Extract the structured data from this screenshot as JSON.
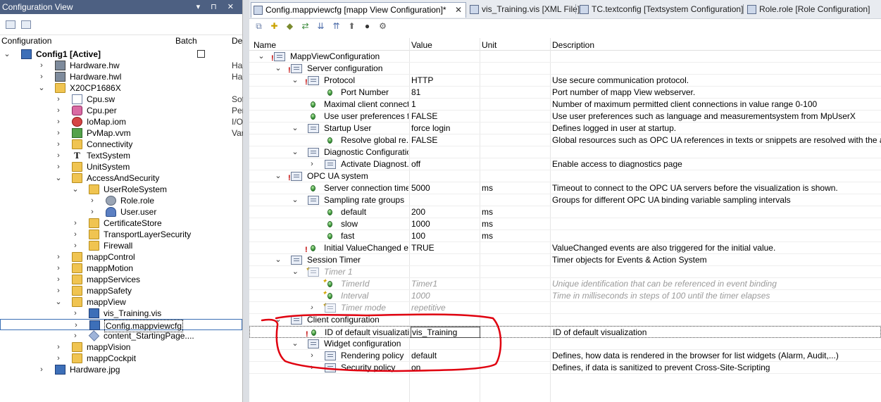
{
  "left_pane": {
    "title": "Configuration View",
    "title_controls": "▾ ⊓ ✕",
    "headers": {
      "configuration": "Configuration",
      "batch": "Batch",
      "desc": "Des"
    },
    "tree": [
      {
        "label": "Config1 [Active]",
        "depth": 0,
        "expander": "⌄",
        "icon": "config-icon",
        "bold": true,
        "extra": ""
      },
      {
        "label": "Hardware.hw",
        "depth": 1,
        "expander": "›",
        "icon": "hardware-icon",
        "extra": "Har"
      },
      {
        "label": "Hardware.hwl",
        "depth": 1,
        "expander": "›",
        "icon": "hardware-icon",
        "extra": "Har"
      },
      {
        "label": "X20CP1686X",
        "depth": 1,
        "expander": "⌄",
        "icon": "cpu-icon",
        "extra": ""
      },
      {
        "label": "Cpu.sw",
        "depth": 2,
        "expander": "›",
        "icon": "file-icon",
        "extra": "Sof"
      },
      {
        "label": "Cpu.per",
        "depth": 2,
        "expander": "›",
        "icon": "gear-icon",
        "extra": "Per"
      },
      {
        "label": "IoMap.iom",
        "depth": 2,
        "expander": "›",
        "icon": "iomap-icon",
        "extra": "I/O"
      },
      {
        "label": "PvMap.vvm",
        "depth": 2,
        "expander": "›",
        "icon": "pvmap-icon",
        "extra": "Var"
      },
      {
        "label": "Connectivity",
        "depth": 2,
        "expander": "›",
        "icon": "folder-icon",
        "extra": ""
      },
      {
        "label": "TextSystem",
        "depth": 2,
        "expander": "›",
        "icon": "text-icon",
        "extra": ""
      },
      {
        "label": "UnitSystem",
        "depth": 2,
        "expander": "›",
        "icon": "folder-icon",
        "extra": ""
      },
      {
        "label": "AccessAndSecurity",
        "depth": 2,
        "expander": "⌄",
        "icon": "security-icon",
        "extra": ""
      },
      {
        "label": "UserRoleSystem",
        "depth": 3,
        "expander": "⌄",
        "icon": "folder-icon",
        "extra": ""
      },
      {
        "label": "Role.role",
        "depth": 4,
        "expander": "›",
        "icon": "role-icon",
        "extra": ""
      },
      {
        "label": "User.user",
        "depth": 4,
        "expander": "›",
        "icon": "user-icon",
        "extra": ""
      },
      {
        "label": "CertificateStore",
        "depth": 3,
        "expander": "›",
        "icon": "folder-icon",
        "extra": ""
      },
      {
        "label": "TransportLayerSecurity",
        "depth": 3,
        "expander": "›",
        "icon": "folder-icon",
        "extra": ""
      },
      {
        "label": "Firewall",
        "depth": 3,
        "expander": "›",
        "icon": "folder-icon",
        "extra": ""
      },
      {
        "label": "mappControl",
        "depth": 2,
        "expander": "›",
        "icon": "folder-icon",
        "extra": ""
      },
      {
        "label": "mappMotion",
        "depth": 2,
        "expander": "›",
        "icon": "folder-icon",
        "extra": ""
      },
      {
        "label": "mappServices",
        "depth": 2,
        "expander": "›",
        "icon": "folder-icon",
        "extra": ""
      },
      {
        "label": "mappSafety",
        "depth": 2,
        "expander": "›",
        "icon": "folder-icon",
        "extra": ""
      },
      {
        "label": "mappView",
        "depth": 2,
        "expander": "⌄",
        "icon": "folder-icon",
        "extra": ""
      },
      {
        "label": "vis_Training.vis",
        "depth": 3,
        "expander": "›",
        "icon": "vis-icon",
        "extra": ""
      },
      {
        "label": "Config.mappviewcfg",
        "depth": 3,
        "expander": "›",
        "icon": "vis-icon",
        "extra": "",
        "selected": true
      },
      {
        "label": "content_StartingPage....",
        "depth": 3,
        "expander": "›",
        "icon": "content-icon",
        "extra": ""
      },
      {
        "label": "mappVision",
        "depth": 2,
        "expander": "›",
        "icon": "folder-icon",
        "extra": ""
      },
      {
        "label": "mappCockpit",
        "depth": 2,
        "expander": "›",
        "icon": "folder-icon",
        "extra": ""
      },
      {
        "label": "Hardware.jpg",
        "depth": 1,
        "expander": "›",
        "icon": "image-icon",
        "extra": ""
      }
    ]
  },
  "tabs": [
    {
      "label": "Config.mappviewcfg [mapp View Configuration]*",
      "active": true,
      "close": "✕"
    },
    {
      "label": "vis_Training.vis [XML File]",
      "active": false
    },
    {
      "label": "TC.textconfig [Textsystem Configuration]",
      "active": false
    },
    {
      "label": "Role.role [Role Configuration]",
      "active": false
    }
  ],
  "toolbar": [
    "⧉",
    "✚",
    "◆",
    "⇄",
    "⇊",
    "⇈",
    "⬆",
    "●",
    "⚙"
  ],
  "grid": {
    "headers": {
      "name": "Name",
      "value": "Value",
      "unit": "Unit",
      "description": "Description"
    },
    "rows": [
      {
        "name": "MappViewConfiguration",
        "depth": 0,
        "exp": "⌄",
        "kind": "obj",
        "warn": true,
        "value": "",
        "unit": "",
        "desc": ""
      },
      {
        "name": "Server configuration",
        "depth": 1,
        "exp": "⌄",
        "kind": "obj",
        "warn": true,
        "value": "",
        "unit": "",
        "desc": ""
      },
      {
        "name": "Protocol",
        "depth": 2,
        "exp": "⌄",
        "kind": "obj",
        "warn": true,
        "value": "HTTP",
        "unit": "",
        "desc": "Use secure communication protocol."
      },
      {
        "name": "Port Number",
        "depth": 3,
        "exp": "",
        "kind": "dot",
        "value": "81",
        "unit": "",
        "desc": "Port number of mapp View webserver."
      },
      {
        "name": "Maximal client connect...",
        "depth": 2,
        "exp": "",
        "kind": "dot",
        "value": "1",
        "unit": "",
        "desc": "Number of maximum permitted client connections in value range 0-100"
      },
      {
        "name": "Use user preferences f...",
        "depth": 2,
        "exp": "",
        "kind": "dot",
        "value": "FALSE",
        "unit": "",
        "desc": "Use user preferences such as language and measurementsystem from MpUserX"
      },
      {
        "name": "Startup User",
        "depth": 2,
        "exp": "⌄",
        "kind": "obj",
        "value": "force login",
        "unit": "",
        "desc": "Defines logged in user at startup."
      },
      {
        "name": "Resolve global re...",
        "depth": 3,
        "exp": "",
        "kind": "dot",
        "value": "FALSE",
        "unit": "",
        "desc": "Global resources such as OPC UA references in texts or snippets are resolved with the anonymous t"
      },
      {
        "name": "Diagnostic Configuration",
        "depth": 2,
        "exp": "⌄",
        "kind": "obj",
        "value": "",
        "unit": "",
        "desc": ""
      },
      {
        "name": "Activate Diagnost...",
        "depth": 3,
        "exp": "›",
        "kind": "obj",
        "value": "off",
        "unit": "",
        "desc": "Enable access to diagnostics page"
      },
      {
        "name": "OPC UA system",
        "depth": 1,
        "exp": "⌄",
        "kind": "obj",
        "warn": true,
        "value": "",
        "unit": "",
        "desc": ""
      },
      {
        "name": "Server connection time...",
        "depth": 2,
        "exp": "",
        "kind": "dot",
        "value": "5000",
        "unit": "ms",
        "desc": "Timeout to connect to the OPC UA servers before the visualization is shown."
      },
      {
        "name": "Sampling rate groups",
        "depth": 2,
        "exp": "⌄",
        "kind": "obj",
        "value": "",
        "unit": "",
        "desc": "Groups for different OPC UA binding variable sampling intervals"
      },
      {
        "name": "default",
        "depth": 3,
        "exp": "",
        "kind": "dot",
        "value": "200",
        "unit": "ms",
        "desc": ""
      },
      {
        "name": "slow",
        "depth": 3,
        "exp": "",
        "kind": "dot",
        "value": "1000",
        "unit": "ms",
        "desc": ""
      },
      {
        "name": "fast",
        "depth": 3,
        "exp": "",
        "kind": "dot",
        "value": "100",
        "unit": "ms",
        "desc": ""
      },
      {
        "name": "Initial ValueChanged e...",
        "depth": 2,
        "exp": "",
        "kind": "dot",
        "warn": true,
        "value": "TRUE",
        "unit": "",
        "desc": "ValueChanged events are also triggered for the initial value."
      },
      {
        "name": "Session Timer",
        "depth": 1,
        "exp": "⌄",
        "kind": "obj",
        "value": "",
        "unit": "",
        "desc": "Timer objects for Events & Action System"
      },
      {
        "name": "Timer 1",
        "depth": 2,
        "exp": "⌄",
        "kind": "obj",
        "dim": true,
        "spark": true,
        "value": "",
        "unit": "",
        "desc": ""
      },
      {
        "name": "TimerId",
        "depth": 3,
        "exp": "",
        "kind": "dot",
        "dim": true,
        "spark": true,
        "value": "Timer1",
        "unit": "",
        "desc": "Unique identification that can be referenced in event binding"
      },
      {
        "name": "Interval",
        "depth": 3,
        "exp": "",
        "kind": "dot",
        "dim": true,
        "spark": true,
        "value": "1000",
        "unit": "",
        "desc": "Time in milliseconds in steps of 100 until the timer elapses"
      },
      {
        "name": "Timer mode",
        "depth": 3,
        "exp": "›",
        "kind": "obj",
        "dim": true,
        "spark": true,
        "value": "repetitive",
        "unit": "",
        "desc": ""
      },
      {
        "name": "Client configuration",
        "depth": 1,
        "exp": "⌄",
        "kind": "obj",
        "value": "",
        "unit": "",
        "desc": ""
      },
      {
        "name": "ID of default visualization",
        "depth": 2,
        "exp": "",
        "kind": "dot",
        "warn": true,
        "value": "vis_Training",
        "unit": "",
        "desc": "ID of default visualization",
        "editing": true
      },
      {
        "name": "Widget configuration",
        "depth": 2,
        "exp": "⌄",
        "kind": "obj",
        "value": "",
        "unit": "",
        "desc": ""
      },
      {
        "name": "Rendering policy",
        "depth": 3,
        "exp": "›",
        "kind": "obj",
        "value": "default",
        "unit": "",
        "desc": "Defines, how data is rendered in the browser for list widgets (Alarm, Audit,...)"
      },
      {
        "name": "Security policy",
        "depth": 3,
        "exp": "›",
        "kind": "obj",
        "value": "on",
        "unit": "",
        "desc": "Defines, if data is sanitized to prevent Cross-Site-Scripting"
      }
    ]
  },
  "colors": {
    "title_bar": "#4d6082",
    "annotation": "#e0000f",
    "warning": "#c00000"
  }
}
